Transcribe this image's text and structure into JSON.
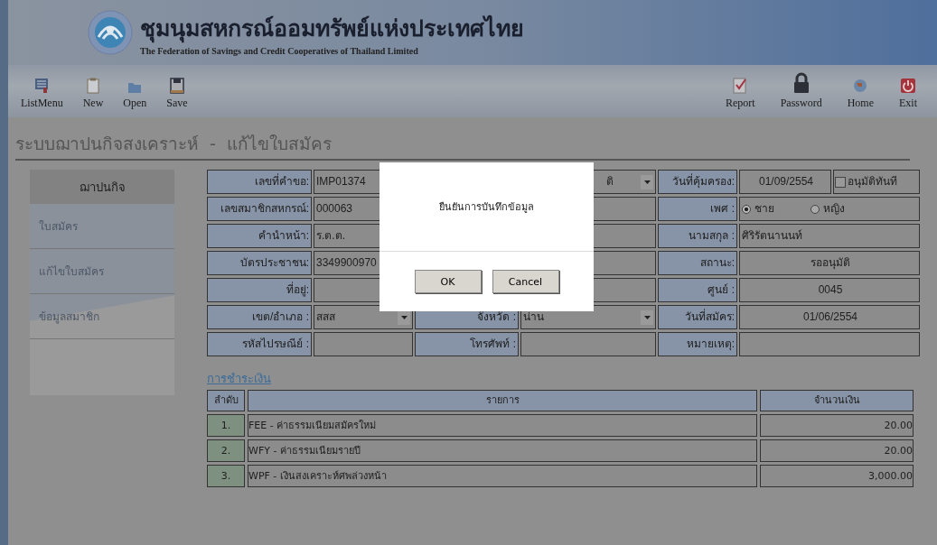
{
  "header": {
    "title": "ชุมนุมสหกรณ์ออมทรัพย์แห่งประเทศไทย",
    "subtitle": "The Federation of Savings and Credit Cooperatives of Thailand Limited"
  },
  "toolbar": {
    "left": [
      {
        "kind": "list",
        "label": "ListMenu"
      },
      {
        "kind": "new",
        "label": "New"
      },
      {
        "kind": "open",
        "label": "Open"
      },
      {
        "kind": "save",
        "label": "Save"
      }
    ],
    "right": [
      {
        "kind": "report",
        "label": "Report"
      },
      {
        "kind": "lock",
        "label": "Password"
      },
      {
        "kind": "home",
        "label": "Home"
      },
      {
        "kind": "exit",
        "label": "Exit"
      }
    ]
  },
  "page_title": "ระบบฌาปนกิจสงเคราะห์  -  แก้ไขใบสมัคร",
  "sidebar": {
    "heading": "ฌาปนกิจ",
    "items": [
      {
        "label": "ใบสมัคร"
      },
      {
        "label": "แก้ไขใบสมัคร"
      },
      {
        "label": "ข้อมูลสมาชิก"
      }
    ]
  },
  "form": [
    [
      {
        "kind": "text",
        "label": "เลขที่คำขอ:",
        "value": "IMP01374",
        "center": false
      },
      {
        "kind": "dropdown",
        "value": "ติ"
      },
      {
        "kind": "date_check",
        "label": "วันที่คุ้มครอง:",
        "value": "01/09/2554",
        "check_label": "อนุมัติทันที",
        "checked": false
      }
    ],
    [
      {
        "kind": "text",
        "label": "เลขสมาชิกสหกรณ์:",
        "value": "000063"
      },
      {
        "kind": "text"
      },
      {
        "kind": "radio",
        "label": "เพศ :",
        "options": [
          {
            "label": "ชาย",
            "selected": true
          },
          {
            "label": "หญิง",
            "selected": false
          }
        ]
      }
    ],
    [
      {
        "kind": "text",
        "label": "คำนำหน้า:",
        "value": "ร.ต.ต."
      },
      {
        "kind": "text"
      },
      {
        "kind": "text",
        "label": "นามสกุล :",
        "value": "ศิริรัตนานนท์"
      }
    ],
    [
      {
        "kind": "text",
        "label": "บัตรประชาชน:",
        "value": "3349900970"
      },
      {
        "kind": "text"
      },
      {
        "kind": "text",
        "label": "สถานะ:",
        "value": "รออนุมัติ",
        "center": true
      }
    ],
    [
      {
        "kind": "text",
        "label": "ที่อยู่:"
      },
      {
        "kind": "text"
      },
      {
        "kind": "text",
        "label": "ศูนย์ :",
        "value": "0045",
        "center": true
      }
    ],
    [
      {
        "kind": "dropdown",
        "label": "เขต/อำเภอ :",
        "value": "สสส"
      },
      {
        "kind": "dropdown",
        "label": "จังหวัด :",
        "value": "น่าน"
      },
      {
        "kind": "text",
        "label": "วันที่สมัคร:",
        "value": "01/06/2554",
        "center": true
      }
    ],
    [
      {
        "kind": "text",
        "label": "รหัสไปรษณีย์ :"
      },
      {
        "kind": "text",
        "label": "โทรศัพท์ :"
      },
      {
        "kind": "text",
        "label": "หมายเหตุ:"
      }
    ]
  ],
  "payment": {
    "title": "การชำระเงิน",
    "columns": [
      "ลำดับ",
      "รายการ",
      "จำนวนเงิน"
    ],
    "rows": [
      [
        "1.",
        "FEE - ค่าธรรมเนียมสมัครใหม่",
        "20.00"
      ],
      [
        "2.",
        "WFY - ค่าธรรมเนียมรายปี",
        "20.00"
      ],
      [
        "3.",
        "WPF - เงินสงเคราะห์ศพล่วงหน้า",
        "3,000.00"
      ]
    ]
  },
  "dialog": {
    "message": "ยืนยันการบันทึกข้อมูล",
    "buttons": [
      "OK",
      "Cancel"
    ]
  }
}
